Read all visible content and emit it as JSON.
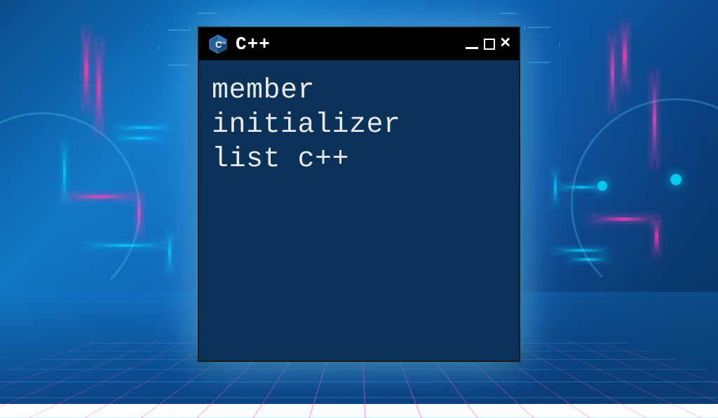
{
  "window": {
    "title": "C++",
    "logo_letter": "C",
    "logo_plus": "++"
  },
  "terminal": {
    "content": "member\ninitializer\nlist c++"
  },
  "controls": {
    "close_symbol": "✕"
  },
  "colors": {
    "terminal_bg": "#0a3258",
    "cyan": "#00d4ff",
    "pink": "#ff3db0"
  }
}
